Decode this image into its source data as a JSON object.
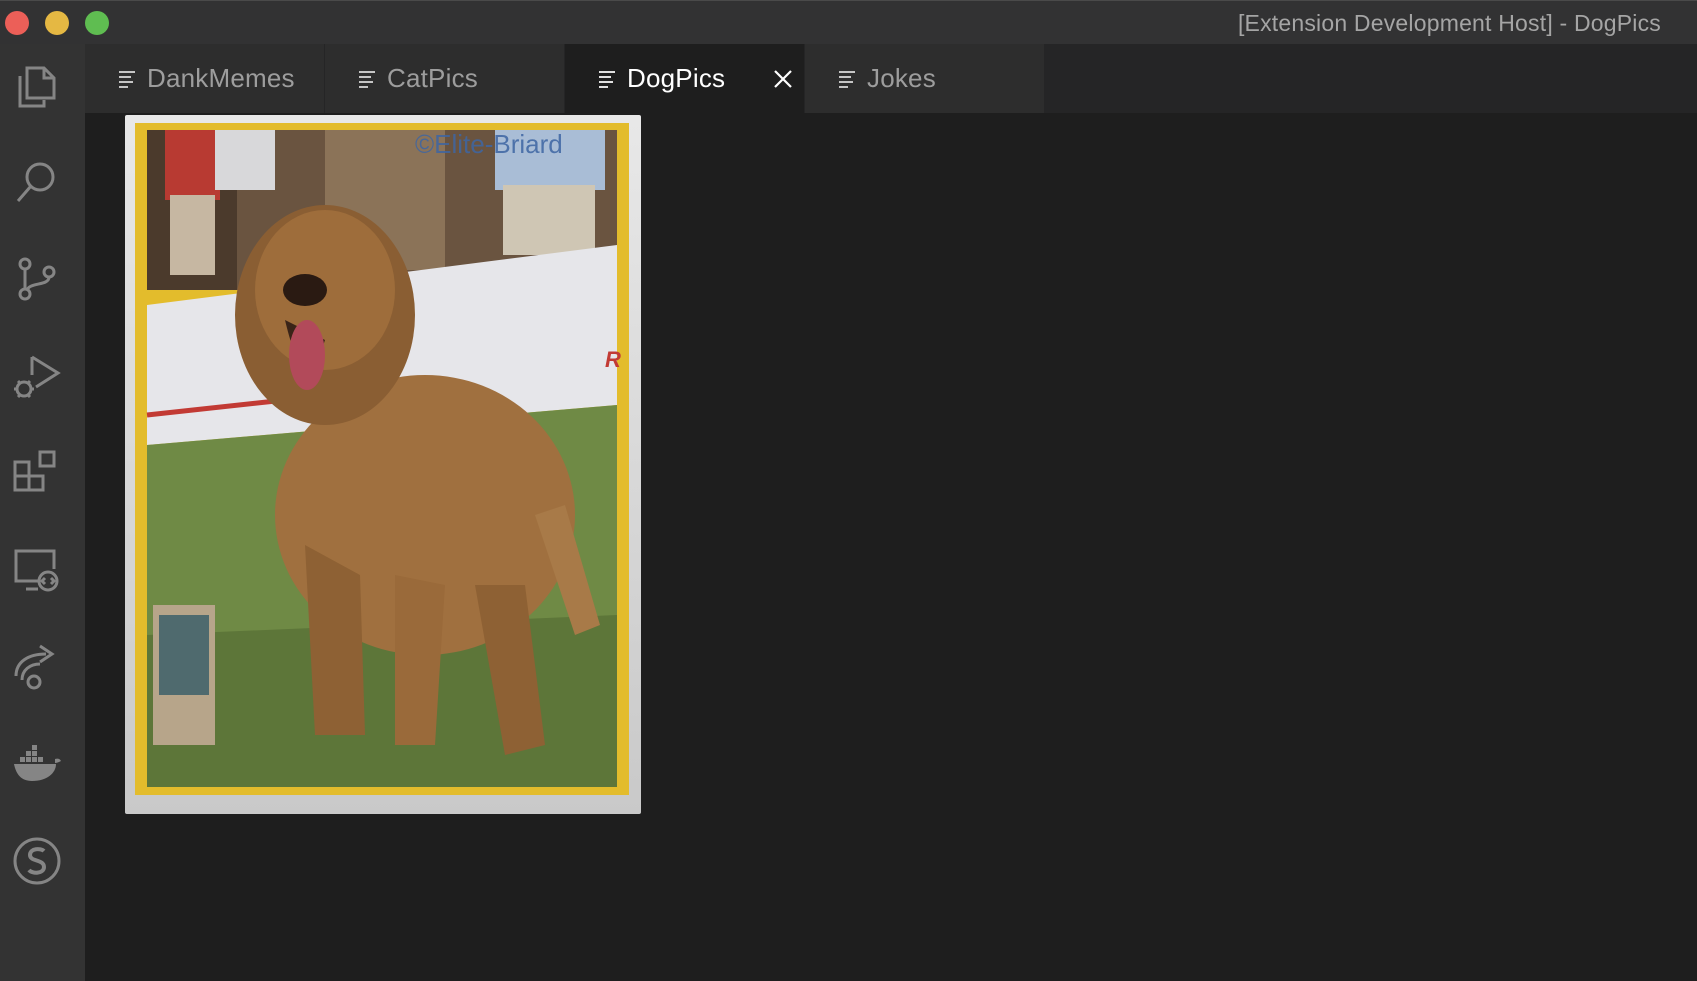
{
  "window": {
    "title": "[Extension Development Host] - DogPics"
  },
  "activity_bar": {
    "items": [
      {
        "icon": "files-icon"
      },
      {
        "icon": "search-icon"
      },
      {
        "icon": "source-control-icon"
      },
      {
        "icon": "run-debug-icon"
      },
      {
        "icon": "extensions-icon"
      },
      {
        "icon": "remote-explorer-icon"
      },
      {
        "icon": "live-share-icon"
      },
      {
        "icon": "docker-icon"
      },
      {
        "icon": "s-account-icon"
      }
    ]
  },
  "tabs": [
    {
      "label": "DankMemes",
      "active": false
    },
    {
      "label": "CatPics",
      "active": false
    },
    {
      "label": "DogPics",
      "active": true
    },
    {
      "label": "Jokes",
      "active": false
    }
  ],
  "editor": {
    "image": {
      "subject": "dog-photo",
      "watermark": "©Elite-Briard"
    }
  },
  "colors": {
    "titlebar": "#323233",
    "activitybar": "#333333",
    "tabbar": "#252526",
    "inactive_tab": "#2d2d2d",
    "editor": "#1e1e1e",
    "close_traffic": "#ec5f58",
    "minimize_traffic": "#e5b843",
    "maximize_traffic": "#5fbd51",
    "photo_border": "#e3bc2c"
  }
}
